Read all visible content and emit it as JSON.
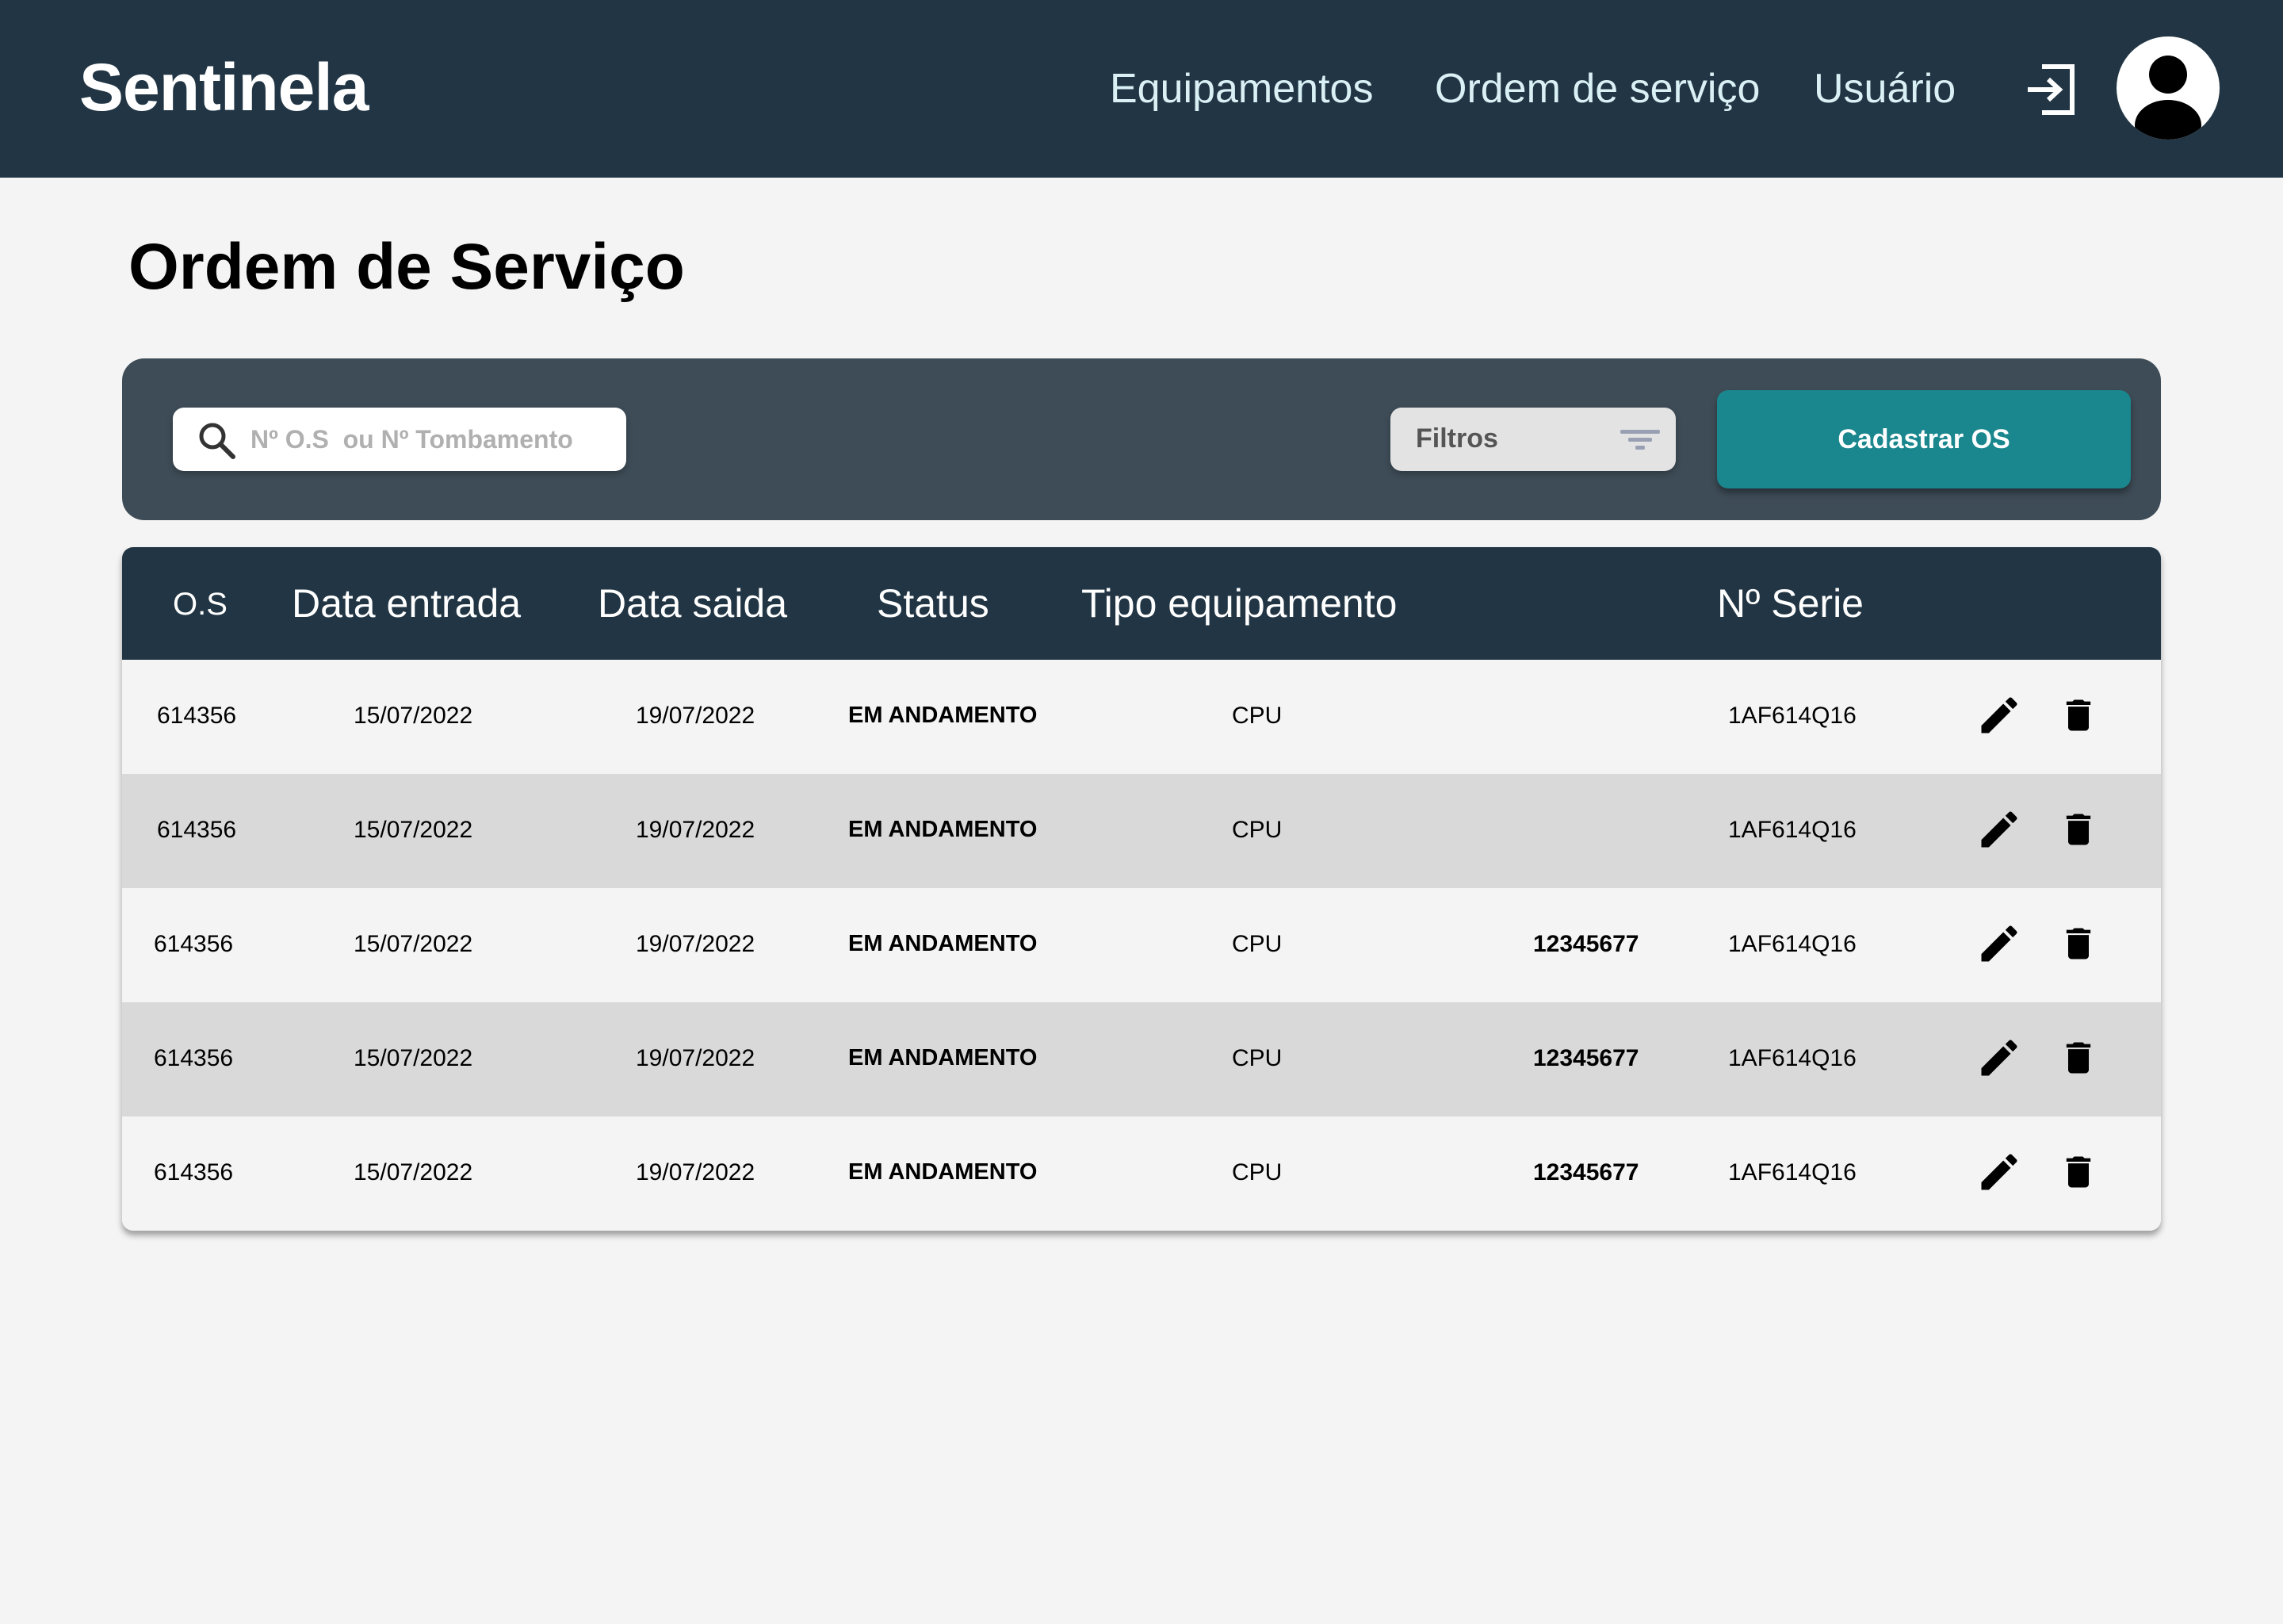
{
  "header": {
    "brand": "Sentinela",
    "nav": [
      {
        "label": "Equipamentos"
      },
      {
        "label": "Ordem de serviço"
      },
      {
        "label": "Usuário"
      }
    ],
    "icons": {
      "logout": "logout-icon",
      "avatar": "user-avatar-icon"
    },
    "background_color": "#213544"
  },
  "page": {
    "title": "Ordem de Serviço"
  },
  "toolbar": {
    "search_placeholder": "Nº O.S  ou Nº Tombamento",
    "filters_label": "Filtros",
    "add_button_label": "Cadastrar OS",
    "accent_color": "#1a868d"
  },
  "table": {
    "columns": [
      "O.S",
      "Data entrada",
      "Data saida",
      "Status",
      "Tipo equipamento",
      "Nº Serie"
    ],
    "rows": [
      {
        "os": "614356",
        "entrada": "15/07/2022",
        "saida": "19/07/2022",
        "status": "EM ANDAMENTO",
        "tipo": "CPU",
        "tombamento": "",
        "serie": "1AF614Q16"
      },
      {
        "os": "614356",
        "entrada": "15/07/2022",
        "saida": "19/07/2022",
        "status": "EM ANDAMENTO",
        "tipo": "CPU",
        "tombamento": "",
        "serie": "1AF614Q16"
      },
      {
        "os": "614356",
        "entrada": "15/07/2022",
        "saida": "19/07/2022",
        "status": "EM ANDAMENTO",
        "tipo": "CPU",
        "tombamento": "12345677",
        "serie": "1AF614Q16"
      },
      {
        "os": "614356",
        "entrada": "15/07/2022",
        "saida": "19/07/2022",
        "status": "EM ANDAMENTO",
        "tipo": "CPU",
        "tombamento": "12345677",
        "serie": "1AF614Q16"
      },
      {
        "os": "614356",
        "entrada": "15/07/2022",
        "saida": "19/07/2022",
        "status": "EM ANDAMENTO",
        "tipo": "CPU",
        "tombamento": "12345677",
        "serie": "1AF614Q16"
      }
    ],
    "row_actions": [
      "edit-icon",
      "trash-icon"
    ]
  }
}
